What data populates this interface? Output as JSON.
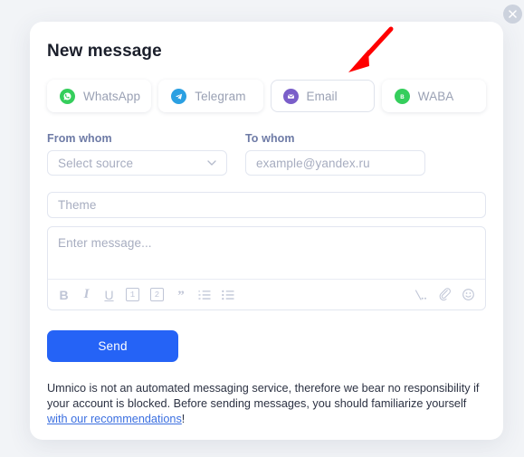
{
  "window": {
    "background_color": "#f2f4f7",
    "close_icon": "close-icon"
  },
  "modal": {
    "title": "New message",
    "background_color": "#ffffff"
  },
  "channels": {
    "items": [
      {
        "label": "WhatsApp",
        "icon": "whatsapp-icon",
        "color": "#35ce5c",
        "selected": false
      },
      {
        "label": "Telegram",
        "icon": "telegram-icon",
        "color": "#2ba0e2",
        "selected": false
      },
      {
        "label": "Email",
        "icon": "email-icon",
        "color": "#7a5ec9",
        "selected": true
      },
      {
        "label": "WABA",
        "icon": "waba-icon",
        "color": "#35ce5c",
        "selected": false
      }
    ]
  },
  "form": {
    "from_label": "From whom",
    "from_placeholder": "Select source",
    "from_value": "",
    "to_label": "To whom",
    "to_placeholder": "example@yandex.ru",
    "to_value": "",
    "theme_placeholder": "Theme",
    "theme_value": "",
    "message_placeholder": "Enter message...",
    "message_value": ""
  },
  "toolbar": {
    "left": [
      {
        "name": "bold-icon",
        "glyph": "B"
      },
      {
        "name": "italic-icon",
        "glyph": "I"
      },
      {
        "name": "underline-icon",
        "glyph": "U"
      },
      {
        "name": "heading-1-icon",
        "glyph": "1"
      },
      {
        "name": "heading-2-icon",
        "glyph": "2"
      },
      {
        "name": "blockquote-icon",
        "glyph": "\""
      },
      {
        "name": "ordered-list-icon",
        "glyph": ""
      },
      {
        "name": "bulleted-list-icon",
        "glyph": ""
      }
    ],
    "right": [
      {
        "name": "variable-icon",
        "glyph": ""
      },
      {
        "name": "attachment-icon",
        "glyph": ""
      },
      {
        "name": "emoji-icon",
        "glyph": ""
      }
    ]
  },
  "actions": {
    "send_label": "Send",
    "send_color": "#2563f6"
  },
  "disclaimer": {
    "text_before": "Umnico is not an automated messaging service, therefore we bear no responsibility if your account is blocked. Before sending messages, you should familiarize yourself ",
    "link_text": "with our recommendations",
    "text_after": "!",
    "link_color": "#3b6fe0"
  },
  "annotation": {
    "arrow_color": "#ff0000",
    "points_to": "Email"
  }
}
